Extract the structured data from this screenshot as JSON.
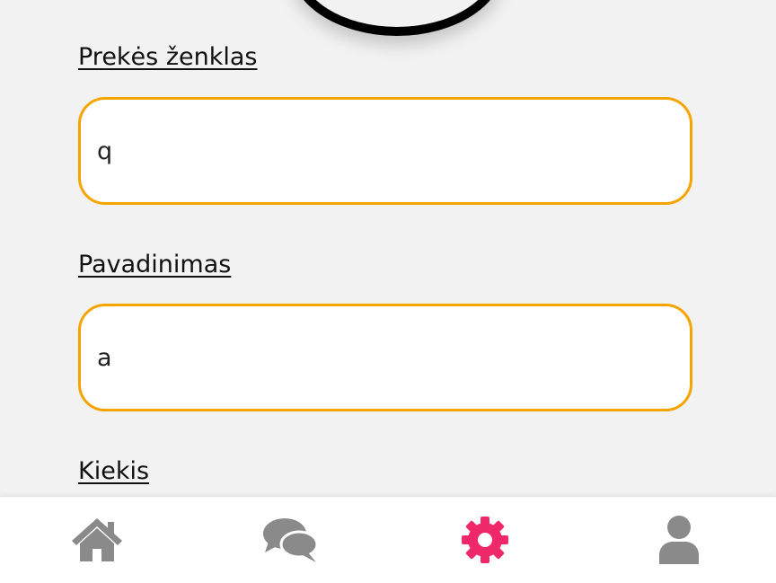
{
  "form": {
    "fields": [
      {
        "label": "Prekės ženklas",
        "value": "q"
      },
      {
        "label": "Pavadinimas",
        "value": "a"
      },
      {
        "label": "Kiekis"
      }
    ]
  },
  "bottom_nav": {
    "items": [
      {
        "icon": "home-icon",
        "active": false
      },
      {
        "icon": "chat-icon",
        "active": false
      },
      {
        "icon": "gear-icon",
        "active": true
      },
      {
        "icon": "user-icon",
        "active": false
      }
    ]
  },
  "colors": {
    "background": "#f2f2f2",
    "input_border": "#f5a400",
    "nav_active": "#ee2869",
    "nav_inactive": "#8a8a8a"
  }
}
